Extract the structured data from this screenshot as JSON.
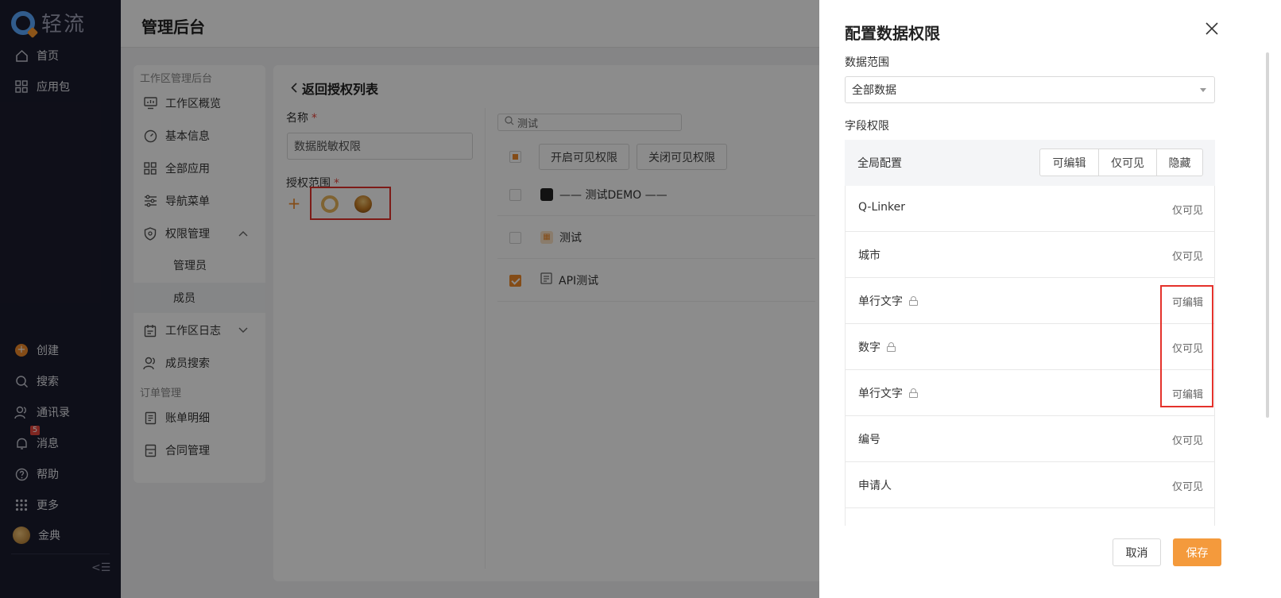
{
  "nav": {
    "logo_text": "轻流",
    "top_items": [
      {
        "label": "首页",
        "icon": "home-icon"
      },
      {
        "label": "应用包",
        "icon": "grid-icon"
      }
    ],
    "bottom_items": [
      {
        "label": "创建",
        "icon": "plus-circle-icon"
      },
      {
        "label": "搜索",
        "icon": "search-icon"
      },
      {
        "label": "通讯录",
        "icon": "contacts-icon"
      },
      {
        "label": "消息",
        "icon": "bell-icon",
        "badge": "5"
      },
      {
        "label": "帮助",
        "icon": "help-icon"
      },
      {
        "label": "更多",
        "icon": "dots-grid-icon"
      },
      {
        "label": "金典",
        "icon": "avatar"
      }
    ],
    "collapse_glyph": "<☰"
  },
  "header": {
    "title": "管理后台"
  },
  "submenu": {
    "group1": "工作区管理后台",
    "items1": [
      {
        "label": "工作区概览",
        "icon": "monitor-icon"
      },
      {
        "label": "基本信息",
        "icon": "gauge-icon"
      },
      {
        "label": "全部应用",
        "icon": "apps-icon"
      },
      {
        "label": "导航菜单",
        "icon": "sliders-icon"
      },
      {
        "label": "权限管理",
        "icon": "shield-icon"
      }
    ],
    "permission_children": [
      "管理员",
      "成员"
    ],
    "items2": [
      {
        "label": "工作区日志",
        "icon": "calendar-icon"
      },
      {
        "label": "成员搜索",
        "icon": "users-icon"
      }
    ],
    "group2": "订单管理",
    "items3": [
      {
        "label": "账单明细",
        "icon": "receipt-icon"
      },
      {
        "label": "合同管理",
        "icon": "contract-icon"
      }
    ]
  },
  "content": {
    "back_label": "返回授权列表",
    "name_label": "名称",
    "name_value": "数据脱敏权限",
    "scope_label": "授权范围",
    "required_mark": "*",
    "search_value": "测试",
    "enable_btn": "开启可见权限",
    "disable_btn": "关闭可见权限",
    "rows": [
      {
        "label": "—— 测试DEMO ——",
        "checked": false,
        "icon_color": "#222222"
      },
      {
        "label": "测试",
        "checked": false,
        "icon_color": "#f08b2a"
      },
      {
        "label": "API测试",
        "checked": true,
        "icon_color": "#666666"
      }
    ]
  },
  "drawer": {
    "title": "配置数据权限",
    "scope_label": "数据范围",
    "scope_value": "全部数据",
    "field_perm_label": "字段权限",
    "global_label": "全局配置",
    "segments": [
      "可编辑",
      "仅可见",
      "隐藏"
    ],
    "fields": [
      {
        "name": "Q-Linker",
        "perm": "仅可见",
        "locked": false
      },
      {
        "name": "城市",
        "perm": "仅可见",
        "locked": false
      },
      {
        "name": "单行文字",
        "perm": "可编辑",
        "locked": true
      },
      {
        "name": "数字",
        "perm": "仅可见",
        "locked": true
      },
      {
        "name": "单行文字",
        "perm": "可编辑",
        "locked": true
      },
      {
        "name": "编号",
        "perm": "仅可见",
        "locked": false
      },
      {
        "name": "申请人",
        "perm": "仅可见",
        "locked": false
      }
    ],
    "cancel_label": "取消",
    "save_label": "保存"
  },
  "colors": {
    "accent": "#f49a3c",
    "highlight": "#e4322b",
    "nav_bg": "#1b1c2e"
  }
}
